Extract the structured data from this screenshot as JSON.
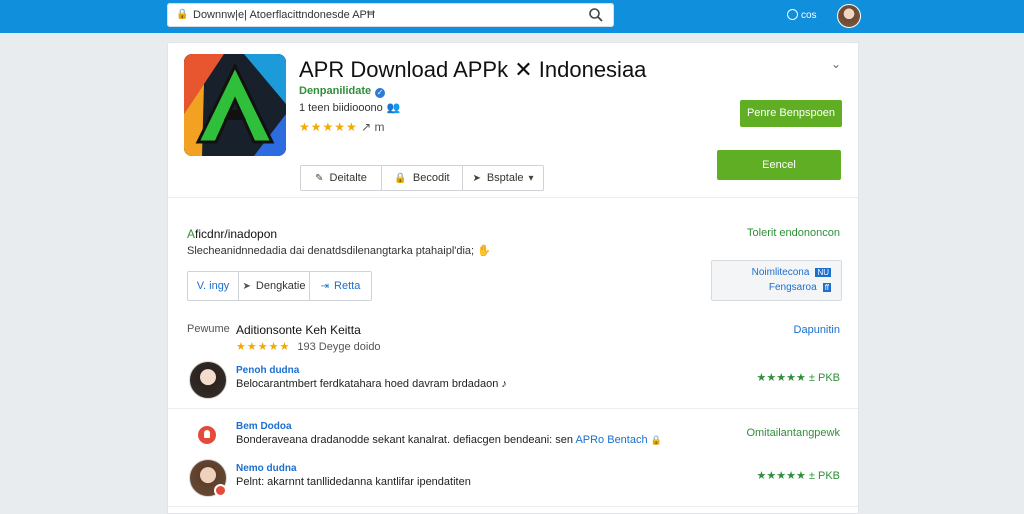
{
  "topbar": {
    "address": "Downnw|e| Atoerflacittndonesde APĦ",
    "account_label": "cos",
    "colors": {
      "bar": "#0f8fdc"
    }
  },
  "app": {
    "title": "APR Download APPk ✕ Indonesiaa",
    "developer": "Denpanilidate",
    "downloads": "1 teen biidiooono",
    "rating_suffix": "↗  m",
    "primary_button": "Penre Benpspoen",
    "secondary_button": "Eencel",
    "segments": [
      {
        "icon": "edit-icon",
        "label": "Deitalte"
      },
      {
        "icon": "lock-icon",
        "label": "Becodit"
      },
      {
        "icon": "share-icon",
        "label": "Bsptale"
      }
    ]
  },
  "about": {
    "title_prefix": "A",
    "title_rest": "ficdnr/inadopon",
    "link": "Tolerit endononcon",
    "desc": "Slecheanidnnedadia dai denatdsdilenangtarka ptahaipl'dia; ✋",
    "tabs": [
      {
        "label": "V. ingy"
      },
      {
        "icon": "tag-icon",
        "label": "Dengkatie"
      },
      {
        "icon": "arrow-icon",
        "label": "Retta"
      }
    ],
    "info_lines": [
      {
        "text": "Noimlitecona",
        "tag": "NU"
      },
      {
        "text": "Fengsaroa",
        "tag": "ff"
      }
    ]
  },
  "reviews": {
    "label": "Pewume",
    "title": "Aditionsonte Keh Keitta",
    "summary": "193 Deyge  doido",
    "link": "Dapunitin",
    "items": [
      {
        "name": "Penoh dudna",
        "text": "Belocarantmbert ferdkatahara hoed davram brdadaon ♪",
        "right": "★★★★★ ± PKB",
        "link": ""
      },
      {
        "name": "Bem Dodoa",
        "text": "Bonderaveana dradanodde sekant kanalrat. defiacgen bendeani: sen ",
        "link": "APRo Bentach",
        "right": "Omitailantangpewk"
      },
      {
        "name": "Nemo dudna",
        "text": "Pelnt: akarnnt tanllidedanna kantlifar ipendatiten",
        "right": "★★★★★ ± PKB",
        "link": ""
      }
    ]
  }
}
